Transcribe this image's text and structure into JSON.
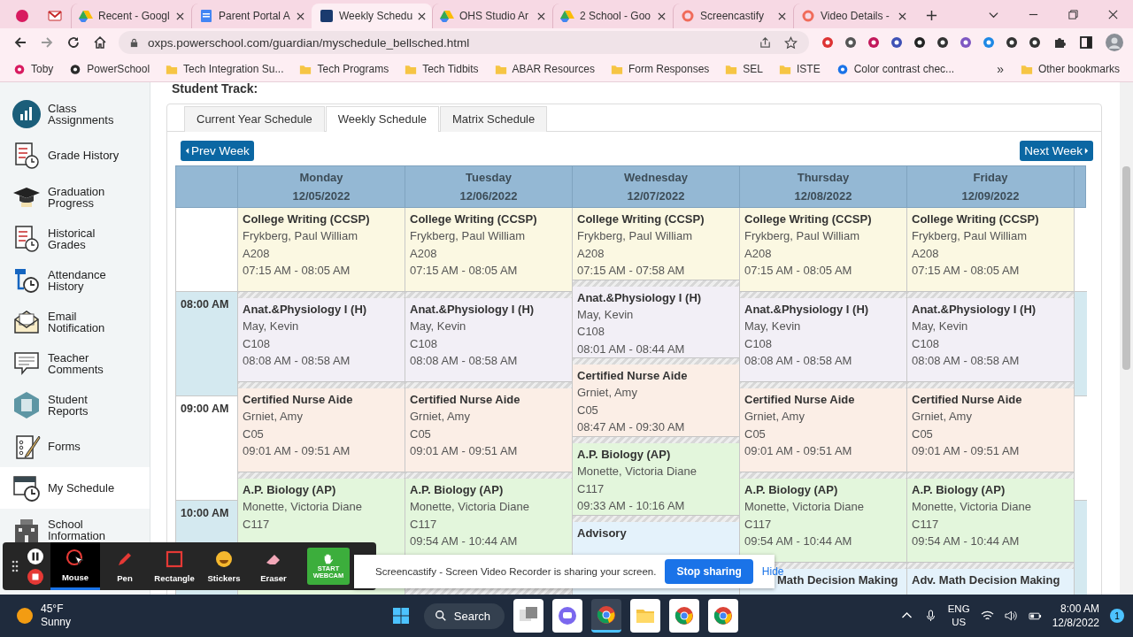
{
  "browser": {
    "tabs": [
      {
        "kind": "pinned",
        "selected": false
      },
      {
        "kind": "pinned",
        "selected": false
      },
      {
        "kind": "page",
        "title": "Recent - Googl",
        "selected": false
      },
      {
        "kind": "page",
        "title": "Parent Portal A",
        "selected": false
      },
      {
        "kind": "page",
        "title": "Weekly Schedu",
        "selected": true
      },
      {
        "kind": "page",
        "title": "OHS Studio Ar",
        "selected": false
      },
      {
        "kind": "page",
        "title": "2 School - Goo",
        "selected": false
      },
      {
        "kind": "page",
        "title": "Screencastify",
        "selected": false
      },
      {
        "kind": "page",
        "title": "Video Details -",
        "selected": false
      }
    ],
    "url": "oxps.powerschool.com/guardian/myschedule_bellsched.html",
    "bookmarks": [
      {
        "kind": "site",
        "label": "Toby"
      },
      {
        "kind": "site",
        "label": "PowerSchool"
      },
      {
        "kind": "folder",
        "label": "Tech Integration Su..."
      },
      {
        "kind": "folder",
        "label": "Tech Programs"
      },
      {
        "kind": "folder",
        "label": "Tech Tidbits"
      },
      {
        "kind": "folder",
        "label": "ABAR Resources"
      },
      {
        "kind": "folder",
        "label": "Form Responses"
      },
      {
        "kind": "folder",
        "label": "SEL"
      },
      {
        "kind": "folder",
        "label": "ISTE"
      },
      {
        "kind": "site",
        "label": "Color contrast chec..."
      }
    ],
    "more_bookmarks": "»",
    "other_bookmarks": "Other bookmarks"
  },
  "sidebar": {
    "items": [
      {
        "label": "Class Assignments",
        "selected": false
      },
      {
        "label": "Grade History",
        "selected": false
      },
      {
        "label": "Graduation Progress",
        "selected": false
      },
      {
        "label": "Historical Grades",
        "selected": false
      },
      {
        "label": "Attendance History",
        "selected": false
      },
      {
        "label": "Email Notification",
        "selected": false
      },
      {
        "label": "Teacher Comments",
        "selected": false
      },
      {
        "label": "Student Reports",
        "selected": false
      },
      {
        "label": "Forms",
        "selected": false
      },
      {
        "label": "My Schedule",
        "selected": true
      },
      {
        "label": "School Information",
        "selected": false
      }
    ]
  },
  "page": {
    "student_track_label": "Student Track:",
    "tabs": [
      {
        "label": "Current Year Schedule",
        "selected": false
      },
      {
        "label": "Weekly Schedule",
        "selected": true
      },
      {
        "label": "Matrix Schedule",
        "selected": false
      }
    ],
    "prev_week": "Prev Week",
    "next_week": "Next Week",
    "time_labels": [
      "08:00 AM",
      "09:00 AM",
      "10:00 AM"
    ],
    "days": [
      {
        "name": "Monday",
        "date": "12/05/2022",
        "events": [
          {
            "title": "College Writing (CCSP)",
            "teacher": "Frykberg, Paul William",
            "room": "A208",
            "time": "07:15 AM - 08:05 AM",
            "color": "#fbf8e2"
          },
          {
            "title": "Anat.&Physiology I (H)",
            "teacher": "May, Kevin",
            "room": "C108",
            "time": "08:08 AM - 08:58 AM",
            "color": "#f2eff6"
          },
          {
            "title": "Certified Nurse Aide",
            "teacher": "Grniet, Amy",
            "room": "C05",
            "time": "09:01 AM - 09:51 AM",
            "color": "#fbeee6"
          },
          {
            "title": "A.P. Biology (AP)",
            "teacher": "Monette, Victoria Diane",
            "room": "C117",
            "color": "#e3f6dc"
          }
        ]
      },
      {
        "name": "Tuesday",
        "date": "12/06/2022",
        "events": [
          {
            "title": "College Writing (CCSP)",
            "teacher": "Frykberg, Paul William",
            "room": "A208",
            "time": "07:15 AM - 08:05 AM",
            "color": "#fbf8e2"
          },
          {
            "title": "Anat.&Physiology I (H)",
            "teacher": "May, Kevin",
            "room": "C108",
            "time": "08:08 AM - 08:58 AM",
            "color": "#f2eff6"
          },
          {
            "title": "Certified Nurse Aide",
            "teacher": "Grniet, Amy",
            "room": "C05",
            "time": "09:01 AM - 09:51 AM",
            "color": "#fbeee6"
          },
          {
            "title": "A.P. Biology (AP)",
            "teacher": "Monette, Victoria Diane",
            "room": "C117",
            "time": "09:54 AM - 10:44 AM",
            "color": "#e3f6dc"
          }
        ]
      },
      {
        "name": "Wednesday",
        "date": "12/07/2022",
        "events": [
          {
            "title": "College Writing (CCSP)",
            "teacher": "Frykberg, Paul William",
            "room": "A208",
            "time": "07:15 AM - 07:58 AM",
            "color": "#fbf8e2"
          },
          {
            "title": "Anat.&Physiology I (H)",
            "teacher": "May, Kevin",
            "room": "C108",
            "time": "08:01 AM - 08:44 AM",
            "color": "#f2eff6"
          },
          {
            "title": "Certified Nurse Aide",
            "teacher": "Grniet, Amy",
            "room": "C05",
            "time": "08:47 AM - 09:30 AM",
            "color": "#fbeee6"
          },
          {
            "title": "A.P. Biology (AP)",
            "teacher": "Monette, Victoria Diane",
            "room": "C117",
            "time": "09:33 AM - 10:16 AM",
            "color": "#e3f6dc"
          },
          {
            "title": "Advisory",
            "color": "#e4f2fb"
          }
        ]
      },
      {
        "name": "Thursday",
        "date": "12/08/2022",
        "events": [
          {
            "title": "College Writing (CCSP)",
            "teacher": "Frykberg, Paul William",
            "room": "A208",
            "time": "07:15 AM - 08:05 AM",
            "color": "#fbf8e2"
          },
          {
            "title": "Anat.&Physiology I (H)",
            "teacher": "May, Kevin",
            "room": "C108",
            "time": "08:08 AM - 08:58 AM",
            "color": "#f2eff6"
          },
          {
            "title": "Certified Nurse Aide",
            "teacher": "Grniet, Amy",
            "room": "C05",
            "time": "09:01 AM - 09:51 AM",
            "color": "#fbeee6"
          },
          {
            "title": "A.P. Biology (AP)",
            "teacher": "Monette, Victoria Diane",
            "room": "C117",
            "time": "09:54 AM - 10:44 AM",
            "color": "#e3f6dc"
          },
          {
            "title": "Math Decision Making",
            "clipped": true,
            "color": "#e4f2fb"
          }
        ]
      },
      {
        "name": "Friday",
        "date": "12/09/2022",
        "events": [
          {
            "title": "College Writing (CCSP)",
            "teacher": "Frykberg, Paul William",
            "room": "A208",
            "time": "07:15 AM - 08:05 AM",
            "color": "#fbf8e2"
          },
          {
            "title": "Anat.&Physiology I (H)",
            "teacher": "May, Kevin",
            "room": "C108",
            "time": "08:08 AM - 08:58 AM",
            "color": "#f2eff6"
          },
          {
            "title": "Certified Nurse Aide",
            "teacher": "Grniet, Amy",
            "room": "C05",
            "time": "09:01 AM - 09:51 AM",
            "color": "#fbeee6"
          },
          {
            "title": "A.P. Biology (AP)",
            "teacher": "Monette, Victoria Diane",
            "room": "C117",
            "time": "09:54 AM - 10:44 AM",
            "color": "#e3f6dc"
          },
          {
            "title": "Adv. Math Decision Making",
            "color": "#e4f2fb"
          }
        ]
      }
    ]
  },
  "recorder": {
    "tools": [
      {
        "label": "Mouse",
        "selected": true
      },
      {
        "label": "Pen",
        "selected": false
      },
      {
        "label": "Rectangle",
        "selected": false
      },
      {
        "label": "Stickers",
        "selected": false
      },
      {
        "label": "Eraser",
        "selected": false
      }
    ],
    "webcam_button": "START WEBCAM"
  },
  "share_bar": {
    "message": "Screencastify - Screen Video Recorder is sharing your screen.",
    "stop_button": "Stop sharing",
    "hide_link": "Hide"
  },
  "taskbar": {
    "temperature": "45°F",
    "condition": "Sunny",
    "search": "Search",
    "apps": [
      {
        "active": false
      },
      {
        "active": false
      },
      {
        "active": true
      },
      {
        "active": false
      },
      {
        "active": false
      },
      {
        "active": false
      }
    ],
    "language": "ENG",
    "region": "US",
    "time": "8:00 AM",
    "date": "12/8/2022",
    "notifications": "1"
  }
}
